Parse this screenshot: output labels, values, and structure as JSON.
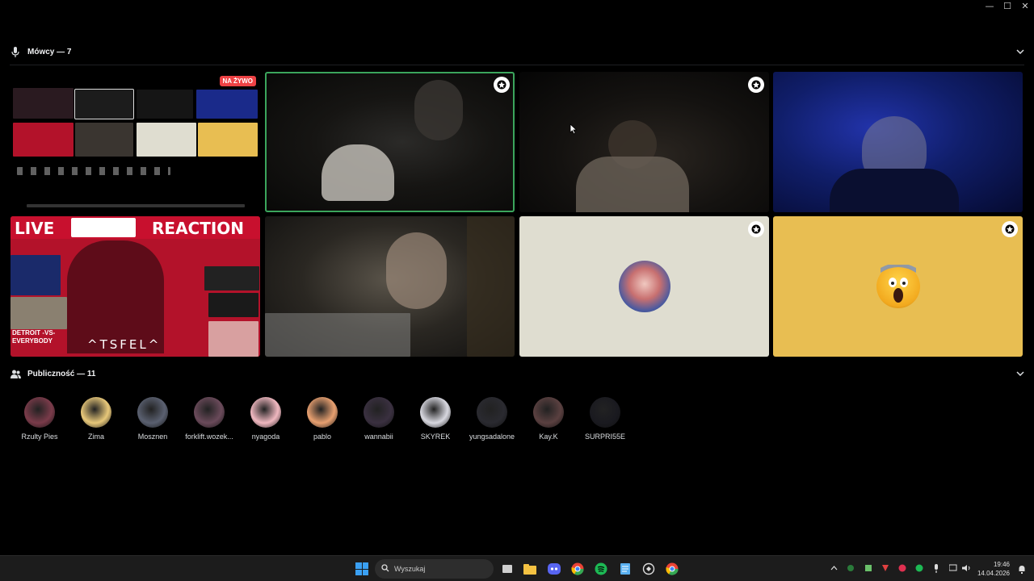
{
  "window": {
    "minimize": "—",
    "maximize": "☐",
    "close": "✕"
  },
  "speakers": {
    "title": "Mówcy — 7"
  },
  "audience": {
    "title": "Publiczność — 11",
    "members": [
      {
        "name": "Rzulty Pies",
        "color": "#7a3b4a"
      },
      {
        "name": "Zima",
        "color": "#e8c87a"
      },
      {
        "name": "Mosznen",
        "color": "#5a6070"
      },
      {
        "name": "forklift.wozek...",
        "color": "#6a4a5a"
      },
      {
        "name": "nyagoda",
        "color": "#f0b8c0"
      },
      {
        "name": "pablo",
        "color": "#e8a070"
      },
      {
        "name": "wannabii",
        "color": "#3a3040"
      },
      {
        "name": "SKYREK",
        "color": "#d8d8e0"
      },
      {
        "name": "yungsadalone",
        "color": "#2a2a30"
      },
      {
        "name": "Kay.K",
        "color": "#5a4040"
      },
      {
        "name": "SURPRI55E",
        "color": "#1a1a20"
      }
    ]
  },
  "tiles": {
    "live_badge": "NA ŻYWO",
    "stream_live": "LIVE",
    "stream_reaction": "REACTION",
    "stream_tag": "^TSFEL^",
    "stream_sub": "DETROIT -VS- EVERYBODY"
  },
  "taskbar": {
    "search_placeholder": "Wyszukaj",
    "time": "19:46",
    "date": "14.04.2026"
  },
  "colors": {
    "active_border": "#3ba55c",
    "live_red": "#ed4245",
    "stream_red": "#b3122a"
  }
}
